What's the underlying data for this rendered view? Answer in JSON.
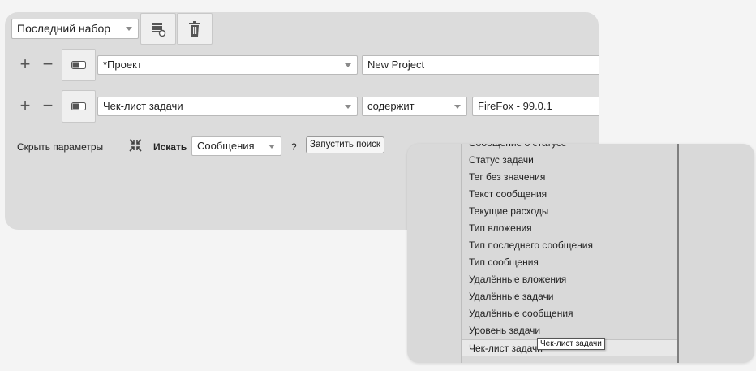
{
  "toolbar": {
    "saved_set_value": "Последний набор",
    "save_icon": "table-save-icon",
    "delete_icon": "trash-icon"
  },
  "filter_rows": [
    {
      "plus": "+",
      "minus": "−",
      "toggle_icon": "toggle-icon",
      "field": "*Проект",
      "value": "New Project"
    },
    {
      "plus": "+",
      "minus": "−",
      "toggle_icon": "toggle-icon",
      "field": "Чек-лист задачи",
      "operator": "содержит",
      "value": "FireFox - 99.0.1"
    }
  ],
  "search_bar": {
    "hide_params": "Скрыть параметры",
    "collapse_icon": "collapse-arrows-icon",
    "search_in_label": "Искать",
    "search_in_value": "Сообщения",
    "help": "?",
    "run_button": "Запустить поиск"
  },
  "dropdown": {
    "items": [
      "Сообщение о статусе",
      "Статус задачи",
      "Тег без значения",
      "Текст сообщения",
      "Текущие расходы",
      "Тип вложения",
      "Тип последнего сообщения",
      "Тип сообщения",
      "Удалённые вложения",
      "Удалённые задачи",
      "Удалённые сообщения",
      "Уровень задачи",
      "Чек-лист задачи"
    ],
    "tooltip": "Чек-лист задачи"
  }
}
